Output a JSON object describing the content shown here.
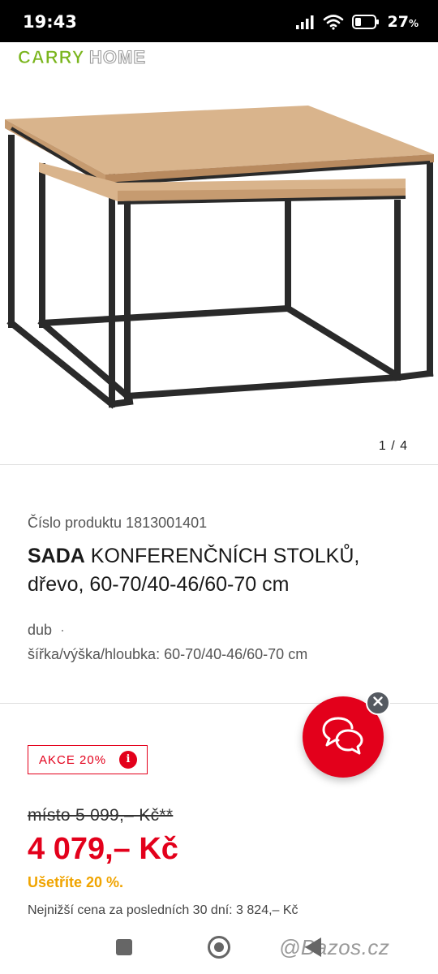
{
  "status_bar": {
    "time": "19:43",
    "battery": "27",
    "battery_unit": "%"
  },
  "logo": {
    "part1": "CARRY",
    "part2": "HOME",
    "colors": {
      "carry": "#7ab51d",
      "home": "#9a9a9a"
    }
  },
  "gallery": {
    "pager": "1 / 4"
  },
  "product": {
    "number": "Číslo produktu 1813001401",
    "title_bold": "SADA",
    "title_rest": " KONFERENČNÍCH STOLKŮ, dřevo, 60-70/40-46/60-70 cm",
    "attr_color": "dub",
    "attr_dot": "·",
    "attr_dims": "šířka/výška/hloubka: 60-70/40-46/60-70 cm"
  },
  "promo": {
    "badge_label": "AKCE 20%",
    "info_icon": "i"
  },
  "pricing": {
    "old_price": "místo 5 099,– Kč**",
    "new_price": "4 079,– Kč",
    "saving": "Ušetříte 20 %.",
    "lowest_price": "Nejnižší cena za posledních 30 dní: 3 824,– Kč"
  },
  "watermark": "@Bazos.cz",
  "colors": {
    "accent": "#e3001b",
    "saving": "#f0a400",
    "fab_close": "#555a61"
  }
}
